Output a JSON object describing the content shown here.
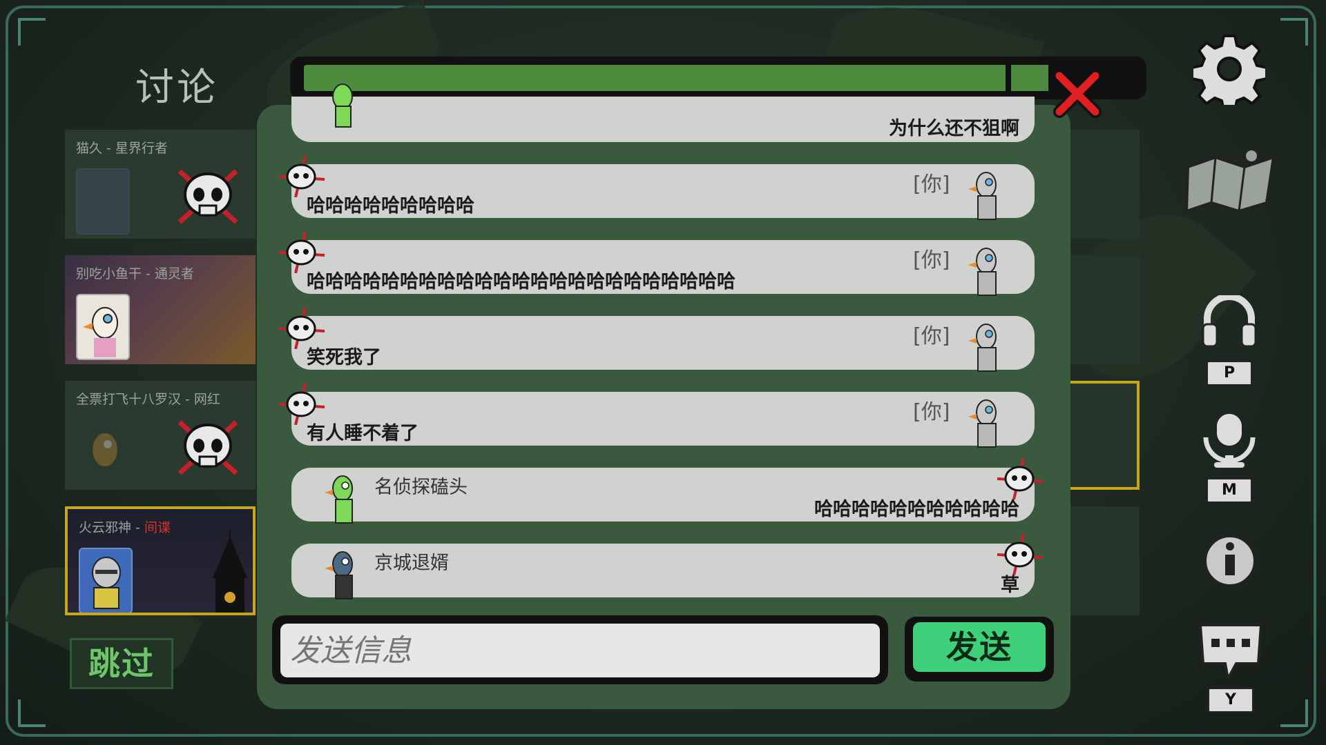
{
  "screen": {
    "title": "讨论"
  },
  "players": [
    {
      "name": "猫久 - 星界行者",
      "role_highlight": "",
      "status": "dead"
    },
    {
      "name": "别吃小鱼干 - 通灵者",
      "role_highlight": "",
      "status": "alive"
    },
    {
      "name": "全票打飞十八罗汉 - 网红",
      "role_highlight": "",
      "status": "dead"
    },
    {
      "name_prefix": "火云邪神 - ",
      "role_highlight": "间谍",
      "status": "alive-selected"
    }
  ],
  "skip_button": "跳过",
  "timer": {
    "progress": 0.92
  },
  "messages": [
    {
      "side": "other",
      "sender": "",
      "text": "为什么还不狙啊"
    },
    {
      "side": "self",
      "tag": "[你]",
      "text": "哈哈哈哈哈哈哈哈哈"
    },
    {
      "side": "self",
      "tag": "[你]",
      "text": "哈哈哈哈哈哈哈哈哈哈哈哈哈哈哈哈哈哈哈哈哈哈哈"
    },
    {
      "side": "self",
      "tag": "[你]",
      "text": "笑死我了"
    },
    {
      "side": "self",
      "tag": "[你]",
      "text": "有人睡不着了"
    },
    {
      "side": "other",
      "sender": "名侦探磕头",
      "text": "哈哈哈哈哈哈哈哈哈哈哈"
    },
    {
      "side": "other",
      "sender": "京城退婿",
      "text": "草"
    }
  ],
  "input": {
    "placeholder": "发送信息",
    "value": ""
  },
  "send_button": "发送",
  "toolbar": {
    "settings_icon": "gear-icon",
    "map_icon": "map-icon",
    "headphones_key": "P",
    "mic_key": "M",
    "info_icon": "info-icon",
    "chat_key": "Y"
  },
  "colors": {
    "progress": "#4d8c3e",
    "send": "#3fd07a",
    "close": "#e02020",
    "selected_border": "#c9a51a"
  }
}
